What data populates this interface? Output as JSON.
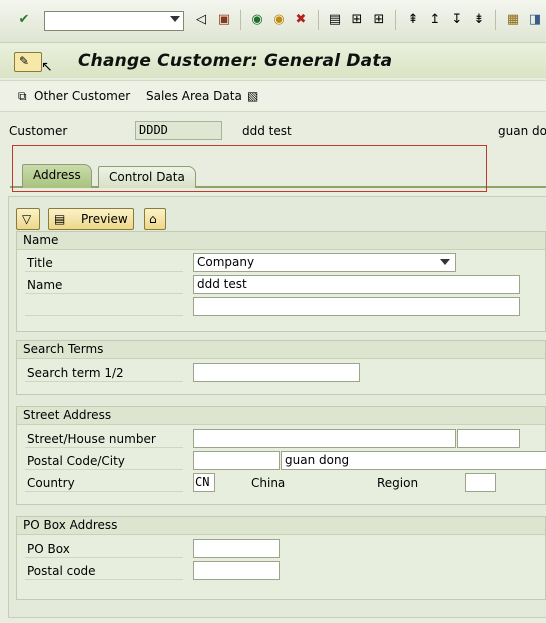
{
  "toolbar": {
    "icons": [
      "enter-icon",
      "back-icon",
      "save-icon",
      "back-nav-icon",
      "exit-icon",
      "cancel-icon",
      "print-icon",
      "find-icon",
      "find-next-icon",
      "first-page-icon",
      "prev-page-icon",
      "next-page-icon",
      "last-page-icon",
      "new-session-icon",
      "shortcut-icon"
    ]
  },
  "title": "Change Customer: General Data",
  "app_toolbar": {
    "other_customer": "Other Customer",
    "sales_area_data": "Sales Area Data"
  },
  "header": {
    "customer_label": "Customer",
    "customer_value": "DDDD",
    "customer_name": "ddd test",
    "city": "guan don"
  },
  "tabs": [
    "Address",
    "Control Data"
  ],
  "buttons": {
    "preview": "Preview"
  },
  "groups": {
    "name": {
      "title": "Name",
      "title_label": "Title",
      "title_value": "Company",
      "name_label": "Name",
      "name_value": "ddd test",
      "name2_value": ""
    },
    "search": {
      "title": "Search Terms",
      "term_label": "Search term 1/2",
      "term_value": ""
    },
    "street": {
      "title": "Street Address",
      "street_label": "Street/House number",
      "postal_label": "Postal Code/City",
      "city_value": "guan dong",
      "country_label": "Country",
      "country_value": "CN",
      "country_name": "China",
      "region_label": "Region"
    },
    "pobox": {
      "title": "PO Box Address",
      "pobox_label": "PO Box",
      "postal_label": "Postal code"
    }
  },
  "colors": {
    "highlight": "#c0392b",
    "accent": "#a9c27f"
  }
}
